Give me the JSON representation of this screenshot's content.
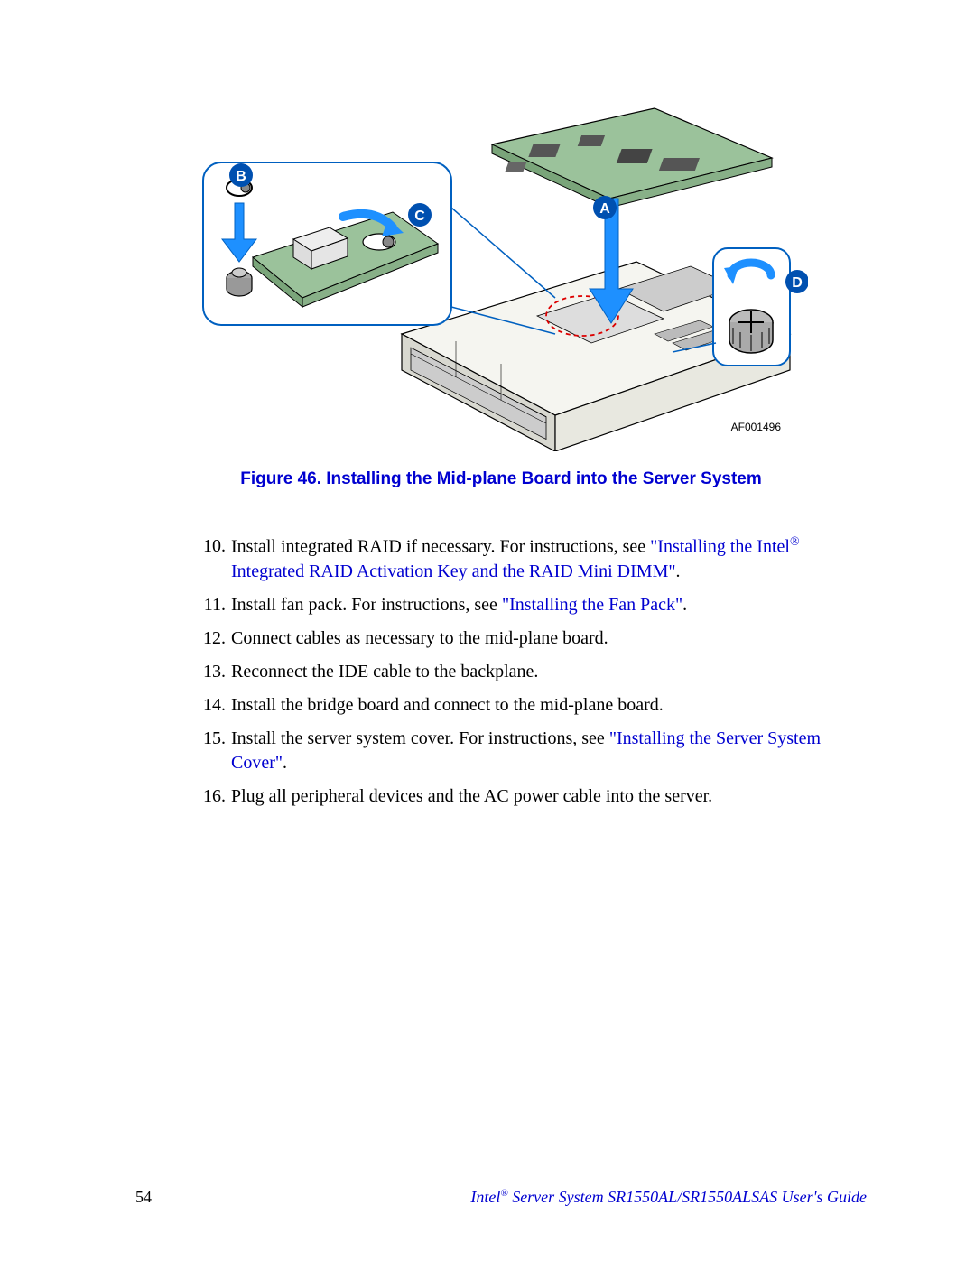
{
  "figure": {
    "id_label": "AF001496",
    "caption": "Figure 46. Installing the Mid-plane Board into the Server System",
    "callouts": {
      "a": "A",
      "b": "B",
      "c": "C",
      "d": "D"
    }
  },
  "steps": [
    {
      "num": "10.",
      "parts": [
        {
          "t": "Install integrated RAID if necessary. For instructions, see "
        },
        {
          "t": "\"Installing the Intel",
          "link": true
        },
        {
          "t": "®",
          "link": true,
          "reg": true
        },
        {
          "t": " Integrated RAID Activation Key and the RAID Mini DIMM\"",
          "link": true
        },
        {
          "t": "."
        }
      ]
    },
    {
      "num": "11.",
      "parts": [
        {
          "t": "Install fan pack. For instructions, see "
        },
        {
          "t": "\"Installing the Fan Pack\"",
          "link": true
        },
        {
          "t": "."
        }
      ]
    },
    {
      "num": "12.",
      "parts": [
        {
          "t": "Connect cables as necessary to the mid-plane board."
        }
      ]
    },
    {
      "num": "13.",
      "parts": [
        {
          "t": "Reconnect the IDE cable to the backplane."
        }
      ]
    },
    {
      "num": "14.",
      "parts": [
        {
          "t": "Install the bridge board and connect to the mid-plane board."
        }
      ]
    },
    {
      "num": "15.",
      "parts": [
        {
          "t": "Install the server system cover. For instructions, see "
        },
        {
          "t": "\"Installing the Server System Cover\"",
          "link": true
        },
        {
          "t": "."
        }
      ]
    },
    {
      "num": "16.",
      "parts": [
        {
          "t": "Plug all peripheral devices and the AC power cable into the server."
        }
      ]
    }
  ],
  "footer": {
    "page_number": "54",
    "title_pre": "Intel",
    "title_reg": "®",
    "title_post": " Server System SR1550AL/SR1550ALSAS User's Guide"
  }
}
